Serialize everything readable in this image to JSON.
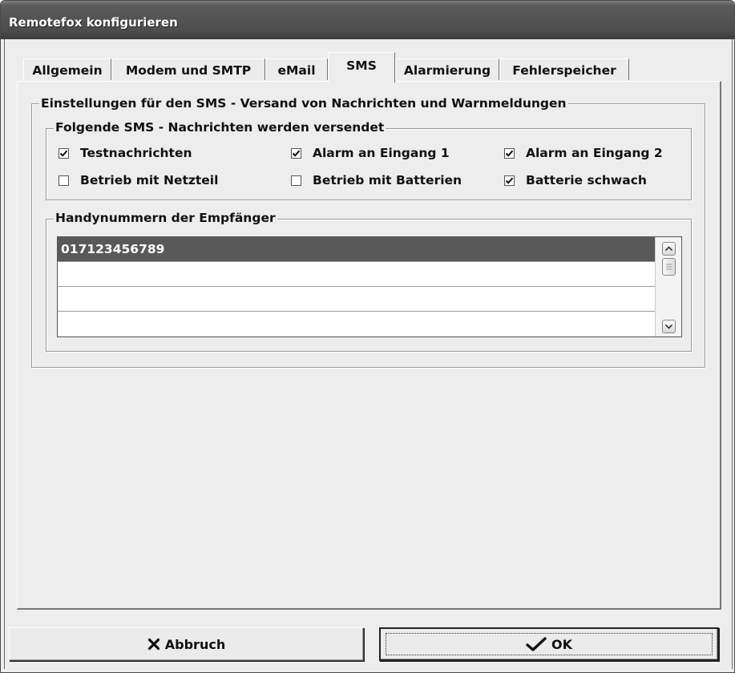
{
  "window": {
    "title": "Remotefox konfigurieren"
  },
  "tabs": [
    {
      "label": "Allgemein"
    },
    {
      "label": "Modem und SMTP"
    },
    {
      "label": "eMail"
    },
    {
      "label": "SMS",
      "active": true
    },
    {
      "label": "Alarmierung"
    },
    {
      "label": "Fehlerspeicher"
    }
  ],
  "sms": {
    "outer_group_label": "Einstellungen für den SMS - Versand von Nachrichten und Warnmeldungen",
    "messages_group_label": "Folgende SMS - Nachrichten werden versendet",
    "checkboxes": [
      {
        "label": "Testnachrichten",
        "checked": true
      },
      {
        "label": "Alarm an Eingang 1",
        "checked": true
      },
      {
        "label": "Alarm an Eingang 2",
        "checked": true
      },
      {
        "label": "Betrieb mit Netzteil",
        "checked": false
      },
      {
        "label": "Betrieb mit Batterien",
        "checked": false
      },
      {
        "label": "Batterie schwach",
        "checked": true
      }
    ],
    "recipients_group_label": "Handynummern der Empfänger",
    "recipients": [
      "017123456789",
      "",
      "",
      ""
    ]
  },
  "buttons": {
    "cancel_label": "Abbruch",
    "cancel_icon": "x-icon",
    "ok_label": "OK",
    "ok_icon": "checkmark-icon"
  }
}
